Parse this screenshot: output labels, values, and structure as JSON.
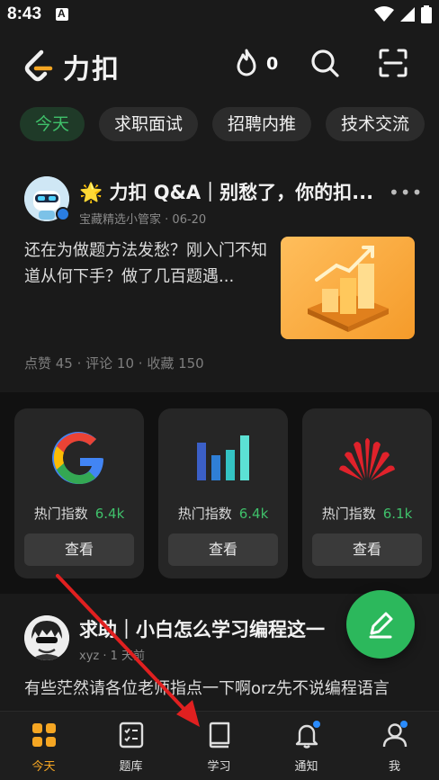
{
  "status": {
    "time": "8:43"
  },
  "header": {
    "logo_text": "力扣",
    "fire_count": "0"
  },
  "chips": [
    "今天",
    "求职面试",
    "招聘内推",
    "技术交流"
  ],
  "post1": {
    "title": "🌟 力扣 Q&A｜别愁了，你的扣...",
    "author": "宝藏精选小管家",
    "date": "· 06-20",
    "body": "还在为做题方法发愁？刚入门不知道从何下手？做了几百题遇...",
    "stats": "点赞 45 · 评论 10 · 收藏 150"
  },
  "companies": [
    {
      "hot_label": "热门指数",
      "hot_value": "6.4k",
      "button": "查看"
    },
    {
      "hot_label": "热门指数",
      "hot_value": "6.4k",
      "button": "查看"
    },
    {
      "hot_label": "热门指数",
      "hot_value": "6.1k",
      "button": "查看"
    }
  ],
  "post2": {
    "title": "求助｜小白怎么学习编程这一",
    "author": "xyz",
    "date": "· 1 天前",
    "body": "有些茫然请各位老师指点一下啊orz先不说编程语言"
  },
  "nav": [
    {
      "label": "今天"
    },
    {
      "label": "题库"
    },
    {
      "label": "学习"
    },
    {
      "label": "通知"
    },
    {
      "label": "我"
    }
  ],
  "colors": {
    "accent_green": "#2cb85c",
    "nav_active": "#f5a623",
    "annotation_arrow": "#e02020"
  }
}
